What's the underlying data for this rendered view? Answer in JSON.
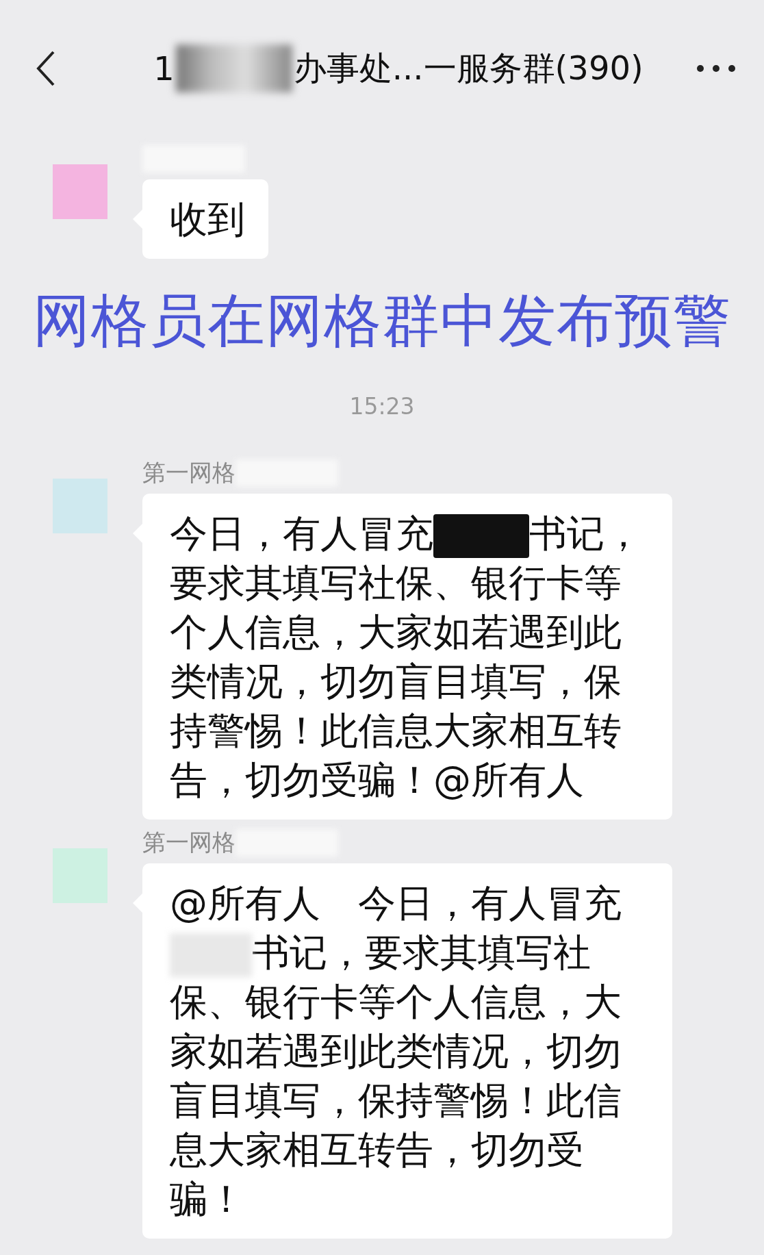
{
  "header": {
    "title_start": "1",
    "title_blurred": true,
    "title_end": "办事处...一服务群(390)"
  },
  "items": [
    {
      "kind": "message",
      "name_blurred": true,
      "parts": [
        {
          "kind": "text",
          "text": "收到"
        }
      ]
    },
    {
      "kind": "caption",
      "text": "网格员在网格群中发布预警"
    },
    {
      "kind": "time",
      "text": "15:23"
    },
    {
      "kind": "message",
      "sender": "第一网格",
      "name_blurred": true,
      "parts": [
        {
          "kind": "text",
          "text": "今日，有人冒充"
        },
        {
          "kind": "redaction"
        },
        {
          "kind": "text",
          "text": "书记，要求其填写社保、银行卡等个人信息，大家如若遇到此类情况，切勿盲目填写，保持警惕！此信息大家相互转告，切勿受骗！@所有人"
        }
      ]
    },
    {
      "kind": "message",
      "sender": "第一网格",
      "name_blurred": true,
      "parts": [
        {
          "kind": "text",
          "text": "@所有人　今日，有人冒充"
        },
        {
          "kind": "smudge"
        },
        {
          "kind": "text",
          "text": "书记，要求其填写社保、银行卡等个人信息，大家如若遇到此类情况，切勿盲目填写，保持警惕！此信息大家相互转告，切勿受骗！"
        }
      ]
    }
  ]
}
